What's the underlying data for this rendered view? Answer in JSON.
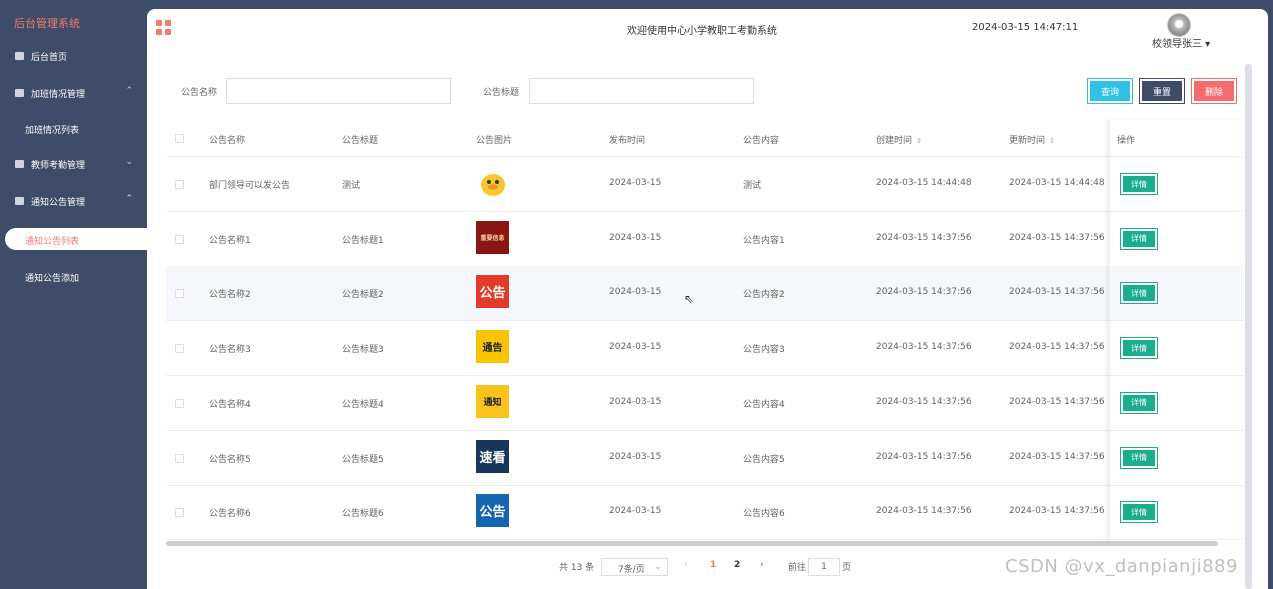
{
  "sidebar": {
    "brand": "后台管理系统",
    "items": [
      {
        "label": "后台首页",
        "icon": "monitor-icon"
      },
      {
        "label": "加班情况管理",
        "icon": "checkbox-icon",
        "expanded": true,
        "children": [
          "加班情况列表"
        ]
      },
      {
        "label": "教师考勤管理",
        "icon": "checkbox-icon",
        "expanded": false
      },
      {
        "label": "通知公告管理",
        "icon": "checkbox-icon",
        "expanded": true,
        "children": [
          "通知公告列表",
          "通知公告添加"
        ]
      }
    ]
  },
  "header": {
    "title": "欢迎使用中心小学教职工考勤系统",
    "datetime": "2024-03-15 14:47:11",
    "user": "校领导张三"
  },
  "filters": {
    "name_label": "公告名称",
    "title_label": "公告标题",
    "query": "查询",
    "reset": "重置",
    "delete": "删除"
  },
  "table": {
    "headers": [
      "公告名称",
      "公告标题",
      "公告图片",
      "发布时间",
      "公告内容",
      "创建时间",
      "更新时间",
      "操作"
    ],
    "detail_label": "详情",
    "rows": [
      {
        "name": "部门领导可以发公告",
        "title": "测试",
        "img": "yellow-duck",
        "pub": "2024-03-15",
        "content": "测试",
        "created": "2024-03-15 14:44:48",
        "updated": "2024-03-15 14:44:48"
      },
      {
        "name": "公告名称1",
        "title": "公告标题1",
        "img": "重要信息",
        "pub": "2024-03-15",
        "content": "公告内容1",
        "created": "2024-03-15 14:37:56",
        "updated": "2024-03-15 14:37:56"
      },
      {
        "name": "公告名称2",
        "title": "公告标题2",
        "img": "公告",
        "pub": "2024-03-15",
        "content": "公告内容2",
        "created": "2024-03-15 14:37:56",
        "updated": "2024-03-15 14:37:56"
      },
      {
        "name": "公告名称3",
        "title": "公告标题3",
        "img": "通告",
        "pub": "2024-03-15",
        "content": "公告内容3",
        "created": "2024-03-15 14:37:56",
        "updated": "2024-03-15 14:37:56"
      },
      {
        "name": "公告名称4",
        "title": "公告标题4",
        "img": "通知",
        "pub": "2024-03-15",
        "content": "公告内容4",
        "created": "2024-03-15 14:37:56",
        "updated": "2024-03-15 14:37:56"
      },
      {
        "name": "公告名称5",
        "title": "公告标题5",
        "img": "速看",
        "pub": "2024-03-15",
        "content": "公告内容5",
        "created": "2024-03-15 14:37:56",
        "updated": "2024-03-15 14:37:56"
      },
      {
        "name": "公告名称6",
        "title": "公告标题6",
        "img": "公告",
        "pub": "2024-03-15",
        "content": "公告内容6",
        "created": "2024-03-15 14:37:56",
        "updated": "2024-03-15 14:37:56"
      }
    ]
  },
  "pagination": {
    "total": "共 13 条",
    "page_size": "7条/页",
    "pages": [
      "1",
      "2"
    ],
    "current": "1",
    "goto_prefix": "前往",
    "goto_value": "1",
    "goto_suffix": "页"
  },
  "watermark": "CSDN @vx_danpianji889",
  "colors": {
    "accent": "#f57a6c",
    "sidebar": "#3d4c68",
    "query": "#31c1e4",
    "delete": "#f66c6c",
    "detail": "#1aae8f"
  }
}
